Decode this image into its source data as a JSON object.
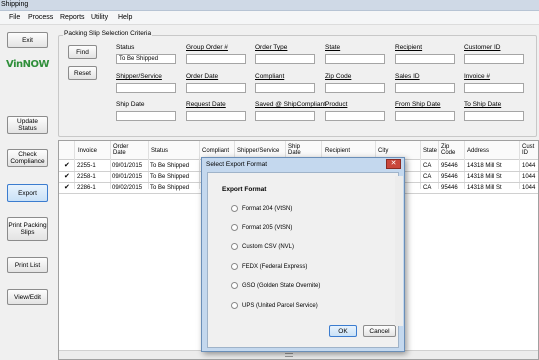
{
  "window": {
    "title": "Shipping"
  },
  "menu": [
    "File",
    "Process",
    "Reports",
    "Utility",
    "Help"
  ],
  "logo": "VinNOW",
  "left_buttons": {
    "exit": "Exit",
    "update_status": "Update Status",
    "check_compliance": "Check Compliance",
    "export": "Export",
    "print_packing_slips": "Print Packing Slips",
    "print_list": "Print List",
    "view_edit": "View/Edit"
  },
  "criteria": {
    "group_title": "Packing Slip Selection Criteria",
    "find": "Find",
    "reset": "Reset",
    "status_label": "Status",
    "status_value": "To Be Shipped",
    "group_order": "Group Order #",
    "order_type": "Order Type",
    "state": "State",
    "recipient": "Recipient",
    "customer_id": "Customer ID",
    "shipper_service": "Shipper/Service",
    "order_date": "Order Date",
    "compliant": "Compliant",
    "zip_code": "Zip Code",
    "sales_id": "Sales ID",
    "invoice": "Invoice #",
    "ship_date": "Ship Date",
    "request_date": "Request Date",
    "saved_ship_compliant": "Saved @ ShipCompliant",
    "product": "Product",
    "from_ship_date": "From Ship Date",
    "to_ship_date": "To Ship Date"
  },
  "grid": {
    "headers": {
      "invoice": "Invoice",
      "order_date": "Order Date",
      "status": "Status",
      "compliant": "Compliant",
      "shipper": "Shipper/Service",
      "ship_date": "Ship Date",
      "recipient": "Recipient",
      "city": "City",
      "state": "State",
      "zip": "Zip Code",
      "address": "Address",
      "cust_id": "Cust ID"
    },
    "rows": [
      {
        "check": "✔",
        "invoice": "2255-1",
        "order_date": "09/01/2015",
        "status": "To Be Shipped",
        "state": "CA",
        "zip": "95446",
        "address": "14318 Mill St",
        "cust_id": "1044"
      },
      {
        "check": "✔",
        "invoice": "2258-1",
        "order_date": "09/01/2015",
        "status": "To Be Shipped",
        "state": "CA",
        "zip": "95446",
        "address": "14318 Mill St",
        "cust_id": "1044"
      },
      {
        "check": "✔",
        "invoice": "2286-1",
        "order_date": "09/02/2015",
        "status": "To Be Shipped",
        "state": "CA",
        "zip": "95446",
        "address": "14318 Mill St",
        "cust_id": "1044"
      }
    ]
  },
  "dialog": {
    "title": "Select Export Format",
    "close": "✕",
    "heading": "Export Format",
    "options": [
      "Format 204 (VtSN)",
      "Format 205 (VtSN)",
      "Custom CSV (NVL)",
      "FEDX  (Federal Express)",
      "GSO  (Golden State Overnite)",
      "UPS  (United Parcel Service)"
    ],
    "ok": "OK",
    "cancel": "Cancel"
  }
}
